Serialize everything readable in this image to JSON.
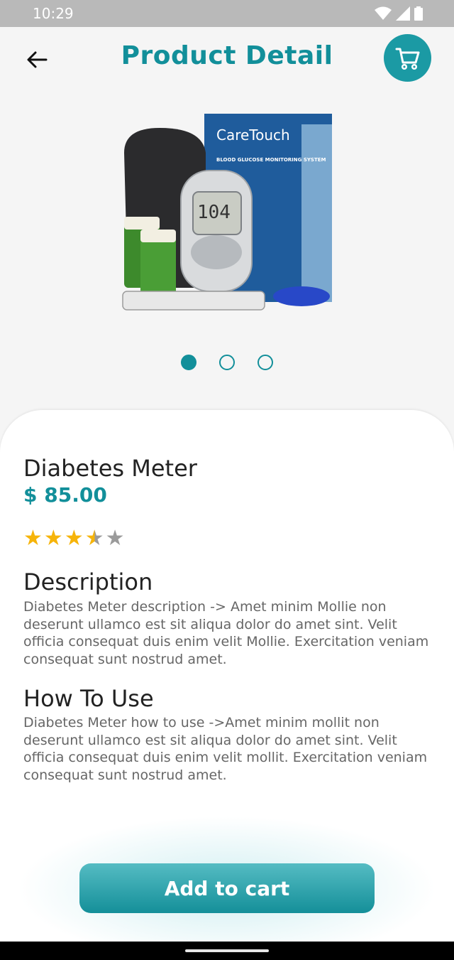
{
  "status_bar": {
    "time": "10:29"
  },
  "header": {
    "title": "Product Detail"
  },
  "product": {
    "name": "Diabetes Meter",
    "price": "$ 85.00",
    "rating": 3.5,
    "rating_max": 5,
    "image_brand": "CareTouch",
    "image_box_text": "BLOOD GLUCOSE MONITORING SYSTEM",
    "image_display": "104",
    "image_count": 3,
    "image_active_index": 0
  },
  "description": {
    "title": "Description",
    "text": "Diabetes Meter description -> Amet minim Mollie non deserunt ullamco est sit aliqua dolor do amet sint. Velit officia consequat duis enim velit Mollie. Exercitation veniam consequat sunt nostrud amet."
  },
  "how_to_use": {
    "title": "How To Use",
    "text": "Diabetes Meter how to use ->Amet minim mollit non deserunt ullamco est sit aliqua dolor do amet sint. Velit officia consequat duis enim velit mollit. Exercitation veniam consequat sunt nostrud amet."
  },
  "actions": {
    "add_to_cart": "Add to cart"
  },
  "colors": {
    "accent": "#128f9a",
    "star": "#f6b40a",
    "star_empty": "#9b9b9b"
  },
  "icons": {
    "back": "arrow-left-icon",
    "cart": "shopping-cart-icon"
  }
}
